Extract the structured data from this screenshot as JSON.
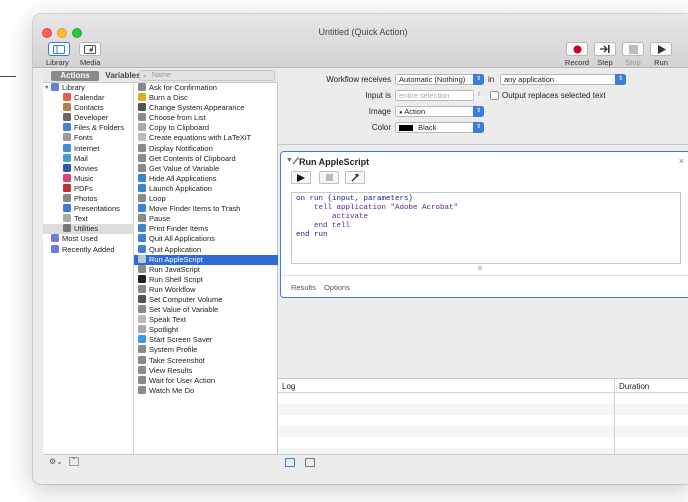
{
  "window": {
    "title": "Untitled (Quick Action)"
  },
  "toolbar": {
    "library_label": "Library",
    "media_label": "Media",
    "record_label": "Record",
    "step_label": "Step",
    "stop_label": "Stop",
    "run_label": "Run"
  },
  "tabs": {
    "actions": "Actions",
    "variables": "Variables"
  },
  "search": {
    "placeholder": "Name"
  },
  "library": [
    {
      "label": "Library",
      "color": "#6a7fd8"
    },
    {
      "label": "Calendar",
      "color": "#e85d4a"
    },
    {
      "label": "Contacts",
      "color": "#b08050"
    },
    {
      "label": "Developer",
      "color": "#666666"
    },
    {
      "label": "Files & Folders",
      "color": "#3b82d8"
    },
    {
      "label": "Fonts",
      "color": "#999999"
    },
    {
      "label": "Internet",
      "color": "#3a8fd8"
    },
    {
      "label": "Mail",
      "color": "#4a9ad8"
    },
    {
      "label": "Movies",
      "color": "#2a5aa8"
    },
    {
      "label": "Music",
      "color": "#e04070"
    },
    {
      "label": "PDFs",
      "color": "#c03030"
    },
    {
      "label": "Photos",
      "color": "#888888"
    },
    {
      "label": "Presentations",
      "color": "#3a7ad8"
    },
    {
      "label": "Text",
      "color": "#aaaaaa"
    },
    {
      "label": "Utilities",
      "color": "#777777"
    },
    {
      "label": "Most Used",
      "color": "#6a7fd8"
    },
    {
      "label": "Recently Added",
      "color": "#6a7fd8"
    }
  ],
  "actions": [
    {
      "label": "Ask for Confirmation",
      "color": "#8a8a8a"
    },
    {
      "label": "Burn a Disc",
      "color": "#d8b020"
    },
    {
      "label": "Change System Appearance",
      "color": "#555555"
    },
    {
      "label": "Choose from List",
      "color": "#8a8a8a"
    },
    {
      "label": "Copy to Clipboard",
      "color": "#aaaaaa"
    },
    {
      "label": "Create equations with LaTeXiT",
      "color": "#bbbbbb"
    },
    {
      "label": "Display Notification",
      "color": "#8a8a8a"
    },
    {
      "label": "Get Contents of Clipboard",
      "color": "#8a8a8a"
    },
    {
      "label": "Get Value of Variable",
      "color": "#8a8a8a"
    },
    {
      "label": "Hide All Applications",
      "color": "#3b82d8"
    },
    {
      "label": "Launch Application",
      "color": "#3b82d8"
    },
    {
      "label": "Loop",
      "color": "#8a8a8a"
    },
    {
      "label": "Move Finder Items to Trash",
      "color": "#3b82d8"
    },
    {
      "label": "Pause",
      "color": "#8a8a8a"
    },
    {
      "label": "Print Finder Items",
      "color": "#3b82d8"
    },
    {
      "label": "Quit All Applications",
      "color": "#3b82d8"
    },
    {
      "label": "Quit Application",
      "color": "#3b82d8"
    },
    {
      "label": "Run AppleScript",
      "color": "#c0c8d8"
    },
    {
      "label": "Run JavaScript",
      "color": "#8a8a8a"
    },
    {
      "label": "Run Shell Script",
      "color": "#222222"
    },
    {
      "label": "Run Workflow",
      "color": "#8a8a8a"
    },
    {
      "label": "Set Computer Volume",
      "color": "#555555"
    },
    {
      "label": "Set Value of Variable",
      "color": "#8a8a8a"
    },
    {
      "label": "Speak Text",
      "color": "#bbbbbb"
    },
    {
      "label": "Spotlight",
      "color": "#aaaaaa"
    },
    {
      "label": "Start Screen Saver",
      "color": "#3a9ae8"
    },
    {
      "label": "System Profile",
      "color": "#8a8a8a"
    },
    {
      "label": "Take Screenshot",
      "color": "#8a8a8a"
    },
    {
      "label": "View Results",
      "color": "#8a8a8a"
    },
    {
      "label": "Wait for User Action",
      "color": "#8a8a8a"
    },
    {
      "label": "Watch Me Do",
      "color": "#8a8a8a"
    }
  ],
  "workflow": {
    "receives_label": "Workflow receives",
    "receives_value": "Automatic (Nothing)",
    "in_label": "in",
    "app_value": "any application",
    "input_label": "Input is",
    "input_value": "entire selection",
    "replace_label": "Output replaces selected text",
    "image_label": "Image",
    "image_value": "Action",
    "color_label": "Color",
    "color_value": "Black"
  },
  "panel": {
    "title": "Run AppleScript",
    "close": "×",
    "code": [
      "on run {input, parameters}",
      "    tell application \"Adobe Acrobat\"",
      "        activate",
      "    end tell",
      "end run"
    ],
    "tab_results": "Results",
    "tab_options": "Options"
  },
  "log": {
    "log_header": "Log",
    "duration_header": "Duration"
  }
}
